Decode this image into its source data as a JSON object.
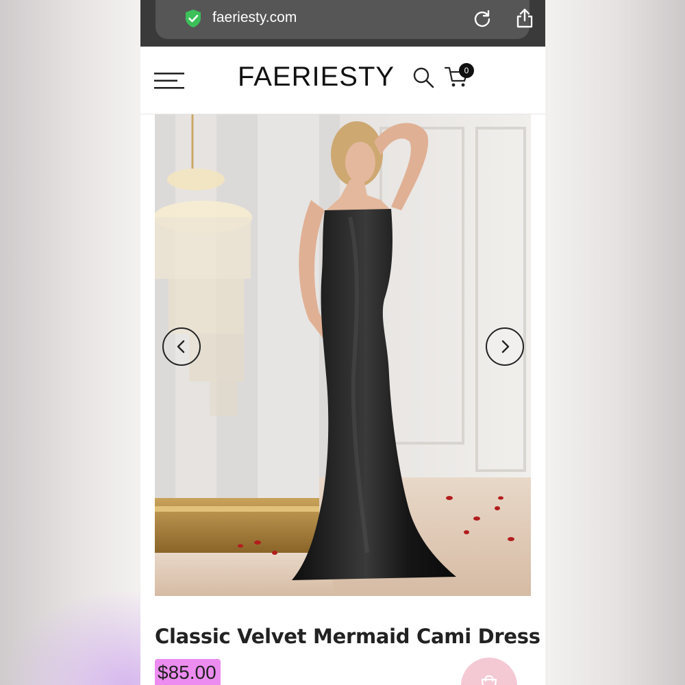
{
  "browser": {
    "url": "faeriesty.com",
    "icons": {
      "secure": "shield-check-icon",
      "reload": "reload-icon",
      "share": "share-icon"
    }
  },
  "header": {
    "brand": "FAERIESTY",
    "cart_count": "0",
    "icons": {
      "menu": "hamburger-icon",
      "search": "search-icon",
      "cart": "cart-icon"
    }
  },
  "gallery": {
    "image_subject": "model in black velvet mermaid dress",
    "prev_icon": "chevron-left-icon",
    "next_icon": "chevron-right-icon"
  },
  "product": {
    "title": "Classic Velvet Mermaid Cami Dress",
    "price": "$85.00",
    "price_highlight_color": "#ec8cf0"
  },
  "fab": {
    "icon": "shopping-bag-icon",
    "color": "#f4c9d4"
  }
}
